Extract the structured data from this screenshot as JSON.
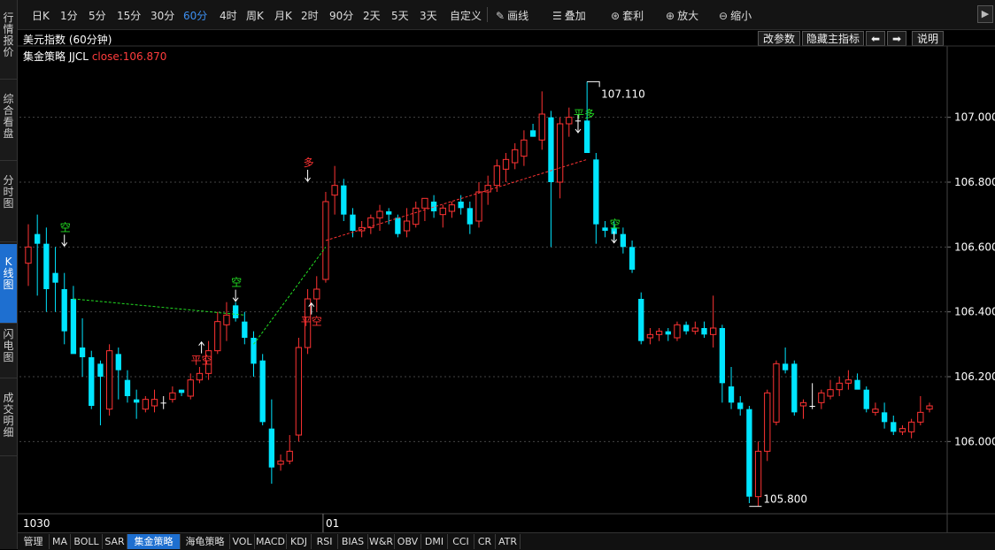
{
  "sidebar": {
    "tabs": [
      {
        "label": "行情报价",
        "active": false
      },
      {
        "label": "综合看盘",
        "active": false
      },
      {
        "label": "分时图",
        "active": false
      },
      {
        "label": "K线图",
        "active": true
      },
      {
        "label": "闪电图",
        "active": false
      },
      {
        "label": "成交明细",
        "active": false
      }
    ]
  },
  "toolbar": {
    "periods": [
      "日K",
      "1分",
      "5分",
      "15分",
      "30分",
      "60分",
      "4时",
      "周K",
      "月K",
      "2时",
      "90分",
      "2天",
      "5天",
      "3天",
      "自定义"
    ],
    "active_period": "60分",
    "tools": [
      {
        "label": "画线",
        "icon": "pencil-icon"
      },
      {
        "label": "叠加",
        "icon": "stack-icon"
      },
      {
        "label": "套利",
        "icon": "arbitrage-icon"
      },
      {
        "label": "放大",
        "icon": "zoom-in-icon"
      },
      {
        "label": "缩小",
        "icon": "zoom-out-icon"
      }
    ],
    "collapse_icon": "chevron-right-icon"
  },
  "chart_header": {
    "title": "美元指数 (60分钟)",
    "indicator_name": "集金策略",
    "indicator_code": "JJCL",
    "close_text": "close:106.870",
    "buttons": {
      "edit_params": "改参数",
      "hide_main": "隐藏主指标",
      "help": "说明"
    }
  },
  "axis": {
    "y_labels": [
      "107.000",
      "106.800",
      "106.600",
      "106.400",
      "106.200",
      "106.000"
    ],
    "x_labels": [
      "1030",
      "01"
    ]
  },
  "annotations": {
    "high_label": "107.110",
    "low_label": "105.800",
    "signals": [
      {
        "text": "空",
        "color": "#22dd22"
      },
      {
        "text": "空",
        "color": "#22dd22"
      },
      {
        "text": "平空",
        "color": "#ff3333"
      },
      {
        "text": "多",
        "color": "#ff3333"
      },
      {
        "text": "平空",
        "color": "#ff3333"
      },
      {
        "text": "平多",
        "color": "#22dd22"
      },
      {
        "text": "空",
        "color": "#22dd22"
      }
    ]
  },
  "bottom_tabs": [
    "管理",
    "MA",
    "BOLL",
    "SAR",
    "集金策略",
    "海龟策略",
    "VOL",
    "MACD",
    "KDJ",
    "RSI",
    "BIAS",
    "W&R",
    "OBV",
    "DMI",
    "CCI",
    "CR",
    "ATR"
  ],
  "bottom_active": "集金策略",
  "colors": {
    "up": "#ff3333",
    "down": "#00e5ff",
    "doji": "#ffffff",
    "accent": "#1e6fd0"
  },
  "chart_data": {
    "type": "candlestick",
    "title": "美元指数 (60分钟)",
    "ylim": [
      105.78,
      107.22
    ],
    "y_ticks": [
      107.0,
      106.8,
      106.6,
      106.4,
      106.2,
      106.0
    ],
    "candles": [
      {
        "o": 106.55,
        "h": 106.67,
        "l": 106.48,
        "c": 106.6
      },
      {
        "o": 106.64,
        "h": 106.7,
        "l": 106.45,
        "c": 106.61
      },
      {
        "o": 106.61,
        "h": 106.66,
        "l": 106.4,
        "c": 106.47
      },
      {
        "o": 106.52,
        "h": 106.6,
        "l": 106.4,
        "c": 106.49
      },
      {
        "o": 106.47,
        "h": 106.52,
        "l": 106.3,
        "c": 106.34
      },
      {
        "o": 106.44,
        "h": 106.48,
        "l": 106.28,
        "c": 106.27
      },
      {
        "o": 106.29,
        "h": 106.38,
        "l": 106.2,
        "c": 106.26
      },
      {
        "o": 106.26,
        "h": 106.28,
        "l": 106.1,
        "c": 106.11
      },
      {
        "o": 106.24,
        "h": 106.25,
        "l": 106.05,
        "c": 106.2
      },
      {
        "o": 106.1,
        "h": 106.3,
        "l": 106.08,
        "c": 106.28
      },
      {
        "o": 106.27,
        "h": 106.29,
        "l": 106.13,
        "c": 106.22
      },
      {
        "o": 106.19,
        "h": 106.22,
        "l": 106.12,
        "c": 106.14
      },
      {
        "o": 106.13,
        "h": 106.16,
        "l": 106.07,
        "c": 106.12
      },
      {
        "o": 106.1,
        "h": 106.14,
        "l": 106.09,
        "c": 106.13
      },
      {
        "o": 106.11,
        "h": 106.16,
        "l": 106.09,
        "c": 106.13
      },
      {
        "o": 106.12,
        "h": 106.14,
        "l": 106.1,
        "c": 106.12
      },
      {
        "o": 106.13,
        "h": 106.17,
        "l": 106.12,
        "c": 106.15
      },
      {
        "o": 106.16,
        "h": 106.16,
        "l": 106.14,
        "c": 106.15
      },
      {
        "o": 106.14,
        "h": 106.21,
        "l": 106.13,
        "c": 106.19
      },
      {
        "o": 106.19,
        "h": 106.23,
        "l": 106.18,
        "c": 106.21
      },
      {
        "o": 106.21,
        "h": 106.31,
        "l": 106.19,
        "c": 106.28
      },
      {
        "o": 106.28,
        "h": 106.4,
        "l": 106.27,
        "c": 106.37
      },
      {
        "o": 106.36,
        "h": 106.43,
        "l": 106.31,
        "c": 106.39
      },
      {
        "o": 106.42,
        "h": 106.43,
        "l": 106.37,
        "c": 106.38
      },
      {
        "o": 106.37,
        "h": 106.4,
        "l": 106.3,
        "c": 106.32
      },
      {
        "o": 106.32,
        "h": 106.34,
        "l": 106.2,
        "c": 106.24
      },
      {
        "o": 106.25,
        "h": 106.27,
        "l": 106.05,
        "c": 106.06
      },
      {
        "o": 106.04,
        "h": 106.13,
        "l": 105.87,
        "c": 105.92
      },
      {
        "o": 105.93,
        "h": 105.96,
        "l": 105.91,
        "c": 105.94
      },
      {
        "o": 105.94,
        "h": 106.02,
        "l": 105.93,
        "c": 105.97
      },
      {
        "o": 106.02,
        "h": 106.32,
        "l": 106.0,
        "c": 106.29
      },
      {
        "o": 106.29,
        "h": 106.47,
        "l": 106.27,
        "c": 106.44
      },
      {
        "o": 106.44,
        "h": 106.51,
        "l": 106.4,
        "c": 106.47
      },
      {
        "o": 106.5,
        "h": 106.77,
        "l": 106.49,
        "c": 106.74
      },
      {
        "o": 106.76,
        "h": 106.85,
        "l": 106.7,
        "c": 106.79
      },
      {
        "o": 106.79,
        "h": 106.81,
        "l": 106.68,
        "c": 106.7
      },
      {
        "o": 106.7,
        "h": 106.72,
        "l": 106.63,
        "c": 106.65
      },
      {
        "o": 106.65,
        "h": 106.68,
        "l": 106.63,
        "c": 106.66
      },
      {
        "o": 106.66,
        "h": 106.7,
        "l": 106.64,
        "c": 106.69
      },
      {
        "o": 106.69,
        "h": 106.73,
        "l": 106.65,
        "c": 106.71
      },
      {
        "o": 106.71,
        "h": 106.72,
        "l": 106.67,
        "c": 106.7
      },
      {
        "o": 106.69,
        "h": 106.7,
        "l": 106.63,
        "c": 106.64
      },
      {
        "o": 106.65,
        "h": 106.72,
        "l": 106.63,
        "c": 106.68
      },
      {
        "o": 106.67,
        "h": 106.74,
        "l": 106.66,
        "c": 106.72
      },
      {
        "o": 106.72,
        "h": 106.74,
        "l": 106.68,
        "c": 106.75
      },
      {
        "o": 106.74,
        "h": 106.76,
        "l": 106.69,
        "c": 106.71
      },
      {
        "o": 106.7,
        "h": 106.73,
        "l": 106.66,
        "c": 106.72
      },
      {
        "o": 106.71,
        "h": 106.74,
        "l": 106.69,
        "c": 106.73
      },
      {
        "o": 106.74,
        "h": 106.76,
        "l": 106.7,
        "c": 106.72
      },
      {
        "o": 106.72,
        "h": 106.74,
        "l": 106.64,
        "c": 106.67
      },
      {
        "o": 106.68,
        "h": 106.8,
        "l": 106.66,
        "c": 106.77
      },
      {
        "o": 106.77,
        "h": 106.82,
        "l": 106.73,
        "c": 106.79
      },
      {
        "o": 106.79,
        "h": 106.87,
        "l": 106.77,
        "c": 106.85
      },
      {
        "o": 106.84,
        "h": 106.89,
        "l": 106.8,
        "c": 106.87
      },
      {
        "o": 106.86,
        "h": 106.92,
        "l": 106.84,
        "c": 106.9
      },
      {
        "o": 106.88,
        "h": 106.96,
        "l": 106.85,
        "c": 106.93
      },
      {
        "o": 106.96,
        "h": 106.98,
        "l": 106.94,
        "c": 106.94
      },
      {
        "o": 106.93,
        "h": 107.08,
        "l": 106.9,
        "c": 107.01
      },
      {
        "o": 107.0,
        "h": 107.02,
        "l": 106.6,
        "c": 106.8
      },
      {
        "o": 106.8,
        "h": 107.0,
        "l": 106.75,
        "c": 106.98
      },
      {
        "o": 106.98,
        "h": 107.03,
        "l": 106.94,
        "c": 107.0
      },
      {
        "o": 106.99,
        "h": 107.01,
        "l": 106.96,
        "c": 106.99
      },
      {
        "o": 106.99,
        "h": 107.11,
        "l": 106.97,
        "c": 106.89
      },
      {
        "o": 106.87,
        "h": 106.89,
        "l": 106.61,
        "c": 106.67
      },
      {
        "o": 106.66,
        "h": 106.68,
        "l": 106.63,
        "c": 106.65
      },
      {
        "o": 106.66,
        "h": 106.68,
        "l": 106.62,
        "c": 106.64
      },
      {
        "o": 106.64,
        "h": 106.66,
        "l": 106.58,
        "c": 106.6
      },
      {
        "o": 106.6,
        "h": 106.62,
        "l": 106.52,
        "c": 106.53
      },
      {
        "o": 106.44,
        "h": 106.46,
        "l": 106.3,
        "c": 106.31
      },
      {
        "o": 106.32,
        "h": 106.35,
        "l": 106.3,
        "c": 106.33
      },
      {
        "o": 106.33,
        "h": 106.35,
        "l": 106.31,
        "c": 106.34
      },
      {
        "o": 106.34,
        "h": 106.35,
        "l": 106.31,
        "c": 106.33
      },
      {
        "o": 106.32,
        "h": 106.37,
        "l": 106.31,
        "c": 106.36
      },
      {
        "o": 106.36,
        "h": 106.37,
        "l": 106.33,
        "c": 106.34
      },
      {
        "o": 106.34,
        "h": 106.37,
        "l": 106.33,
        "c": 106.35
      },
      {
        "o": 106.35,
        "h": 106.37,
        "l": 106.32,
        "c": 106.33
      },
      {
        "o": 106.33,
        "h": 106.45,
        "l": 106.29,
        "c": 106.35
      },
      {
        "o": 106.35,
        "h": 106.36,
        "l": 106.12,
        "c": 106.18
      },
      {
        "o": 106.17,
        "h": 106.23,
        "l": 106.1,
        "c": 106.12
      },
      {
        "o": 106.12,
        "h": 106.14,
        "l": 106.08,
        "c": 106.1
      },
      {
        "o": 106.1,
        "h": 106.11,
        "l": 105.81,
        "c": 105.83
      },
      {
        "o": 105.83,
        "h": 106.0,
        "l": 105.8,
        "c": 105.97
      },
      {
        "o": 105.97,
        "h": 106.16,
        "l": 105.94,
        "c": 106.15
      },
      {
        "o": 106.06,
        "h": 106.25,
        "l": 106.05,
        "c": 106.24
      },
      {
        "o": 106.24,
        "h": 106.29,
        "l": 106.21,
        "c": 106.22
      },
      {
        "o": 106.24,
        "h": 106.25,
        "l": 106.08,
        "c": 106.09
      },
      {
        "o": 106.11,
        "h": 106.13,
        "l": 106.07,
        "c": 106.12
      },
      {
        "o": 106.11,
        "h": 106.18,
        "l": 106.1,
        "c": 106.11
      },
      {
        "o": 106.12,
        "h": 106.16,
        "l": 106.1,
        "c": 106.15
      },
      {
        "o": 106.14,
        "h": 106.19,
        "l": 106.13,
        "c": 106.16
      },
      {
        "o": 106.16,
        "h": 106.2,
        "l": 106.14,
        "c": 106.18
      },
      {
        "o": 106.18,
        "h": 106.22,
        "l": 106.16,
        "c": 106.19
      },
      {
        "o": 106.19,
        "h": 106.21,
        "l": 106.17,
        "c": 106.16
      },
      {
        "o": 106.16,
        "h": 106.17,
        "l": 106.09,
        "c": 106.1
      },
      {
        "o": 106.09,
        "h": 106.12,
        "l": 106.08,
        "c": 106.1
      },
      {
        "o": 106.09,
        "h": 106.12,
        "l": 106.04,
        "c": 106.06
      },
      {
        "o": 106.06,
        "h": 106.08,
        "l": 106.02,
        "c": 106.03
      },
      {
        "o": 106.03,
        "h": 106.05,
        "l": 106.02,
        "c": 106.04
      },
      {
        "o": 106.03,
        "h": 106.07,
        "l": 106.01,
        "c": 106.06
      },
      {
        "o": 106.06,
        "h": 106.14,
        "l": 106.05,
        "c": 106.09
      },
      {
        "o": 106.1,
        "h": 106.12,
        "l": 106.09,
        "c": 106.11
      }
    ]
  }
}
